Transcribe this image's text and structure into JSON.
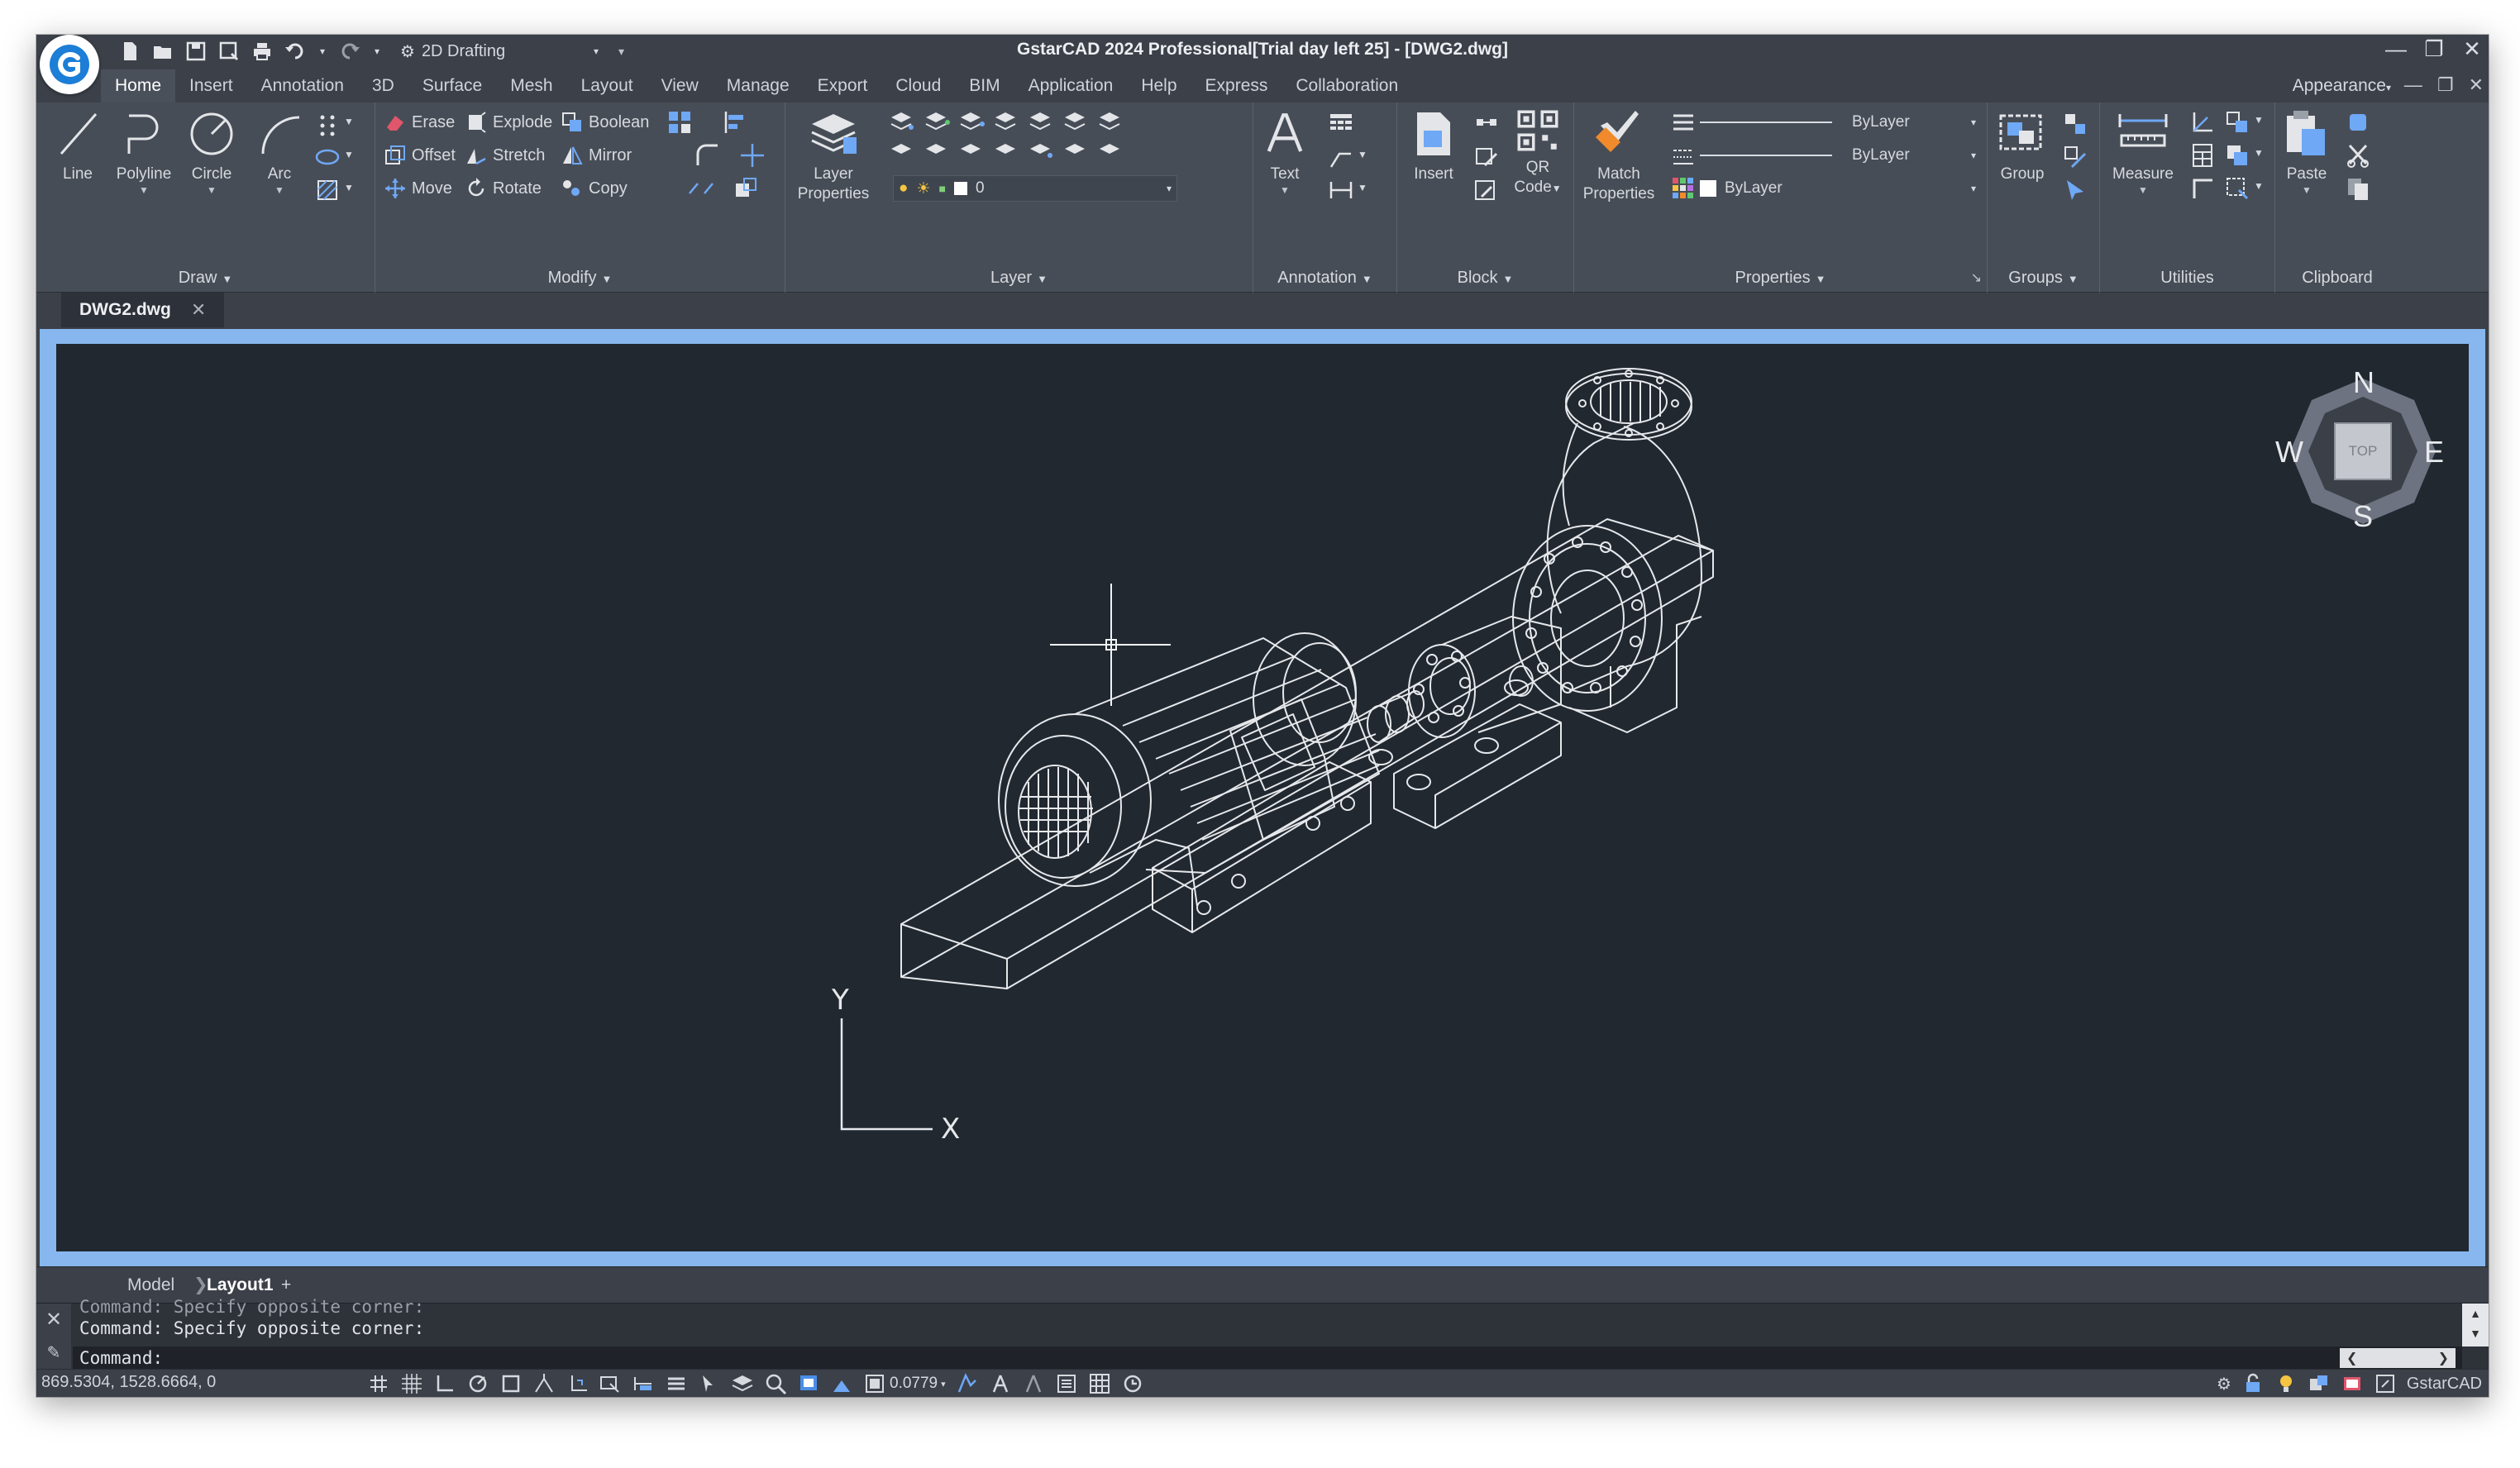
{
  "window": {
    "title": "GstarCAD 2024 Professional[Trial day left 25] - [DWG2.dwg]",
    "workspace": "2D Drafting"
  },
  "menu": {
    "tabs": [
      "Home",
      "Insert",
      "Annotation",
      "3D",
      "Surface",
      "Mesh",
      "Layout",
      "View",
      "Manage",
      "Export",
      "Cloud",
      "BIM",
      "Application",
      "Help",
      "Express",
      "Collaboration"
    ],
    "active_tab": "Home",
    "appearance": "Appearance"
  },
  "ribbon": {
    "draw": {
      "title": "Draw",
      "line": "Line",
      "polyline": "Polyline",
      "circle": "Circle",
      "arc": "Arc"
    },
    "modify": {
      "title": "Modify",
      "erase": "Erase",
      "explode": "Explode",
      "boolean": "Boolean",
      "offset": "Offset",
      "stretch": "Stretch",
      "mirror": "Mirror",
      "move": "Move",
      "rotate": "Rotate",
      "copy": "Copy"
    },
    "layer": {
      "title": "Layer",
      "properties_l1": "Layer",
      "properties_l2": "Properties",
      "current_layer": "0"
    },
    "annotation": {
      "title": "Annotation",
      "text": "Text"
    },
    "block": {
      "title": "Block",
      "insert": "Insert",
      "qr_l1": "QR",
      "qr_l2": "Code"
    },
    "properties": {
      "title": "Properties",
      "match_l1": "Match",
      "match_l2": "Properties",
      "linetype": "ByLayer",
      "lineweight": "ByLayer",
      "color": "ByLayer"
    },
    "groups": {
      "title": "Groups",
      "group": "Group"
    },
    "utilities": {
      "title": "Utilities",
      "measure": "Measure"
    },
    "clipboard": {
      "title": "Clipboard",
      "paste": "Paste"
    }
  },
  "document_tab": {
    "name": "DWG2.dwg"
  },
  "viewcube": {
    "north": "N",
    "south": "S",
    "east": "E",
    "west": "W",
    "face": "TOP"
  },
  "ucs": {
    "x": "X",
    "y": "Y"
  },
  "layout_tabs": {
    "model": "Model",
    "layout1": "Layout1",
    "add": "+"
  },
  "command": {
    "history_partial": "Command: Specify opposite corner:",
    "history_last": "Command: Specify opposite corner:",
    "prompt": "Command:"
  },
  "status": {
    "coordinates": "869.5304, 1528.6664, 0",
    "transparency": "0.0779",
    "brand": "GstarCAD"
  },
  "colors": {
    "canvas_bg": "#212830",
    "viewport_border": "#87b7ee",
    "ribbon_bg": "#474d57",
    "accent_blue": "#1c7ed6"
  }
}
